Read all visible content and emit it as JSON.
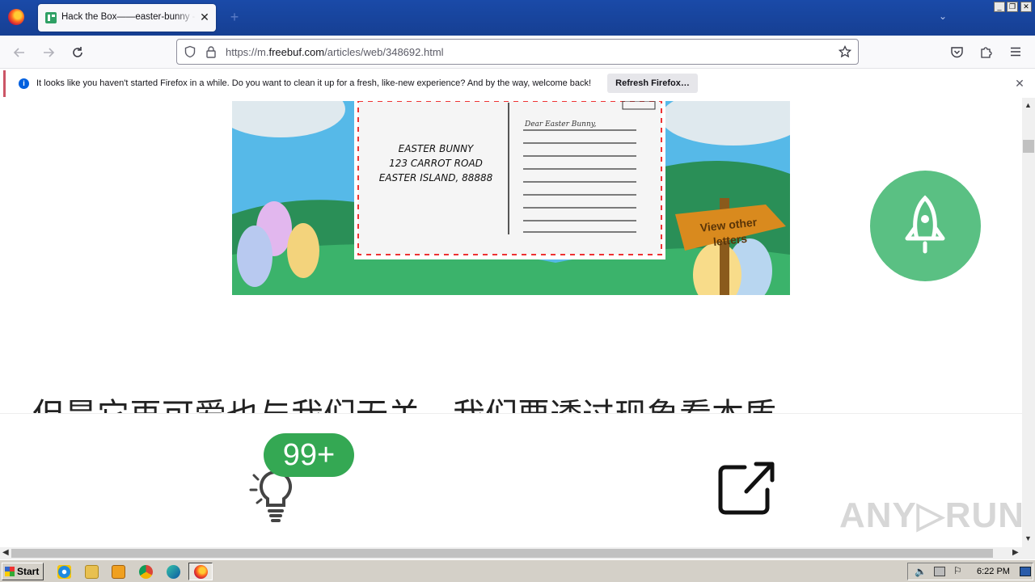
{
  "browser": {
    "tab": {
      "title": "Hack the Box——easter-bunny - FreeBuf",
      "close": "✕"
    },
    "new_tab": "+",
    "url": {
      "prefix": "https://m.",
      "domain": "freebuf.com",
      "path": "/articles/web/348692.html"
    },
    "window_buttons": [
      "_",
      "❐",
      "✕"
    ]
  },
  "notification": {
    "message": "It looks like you haven't started Firefox in a while. Do you want to clean it up for a fresh, like-new experience? And by the way, welcome back!",
    "button": "Refresh Firefox…",
    "close": "✕",
    "info": "i"
  },
  "banner": {
    "address_lines": [
      "EASTER BUNNY",
      "123 CARROT ROAD",
      "EASTER ISLAND, 88888"
    ],
    "greeting": "Dear Easter Bunny,",
    "sign": [
      "View other",
      "letters"
    ]
  },
  "article": {
    "heading": "但是它再可爱也与我们无关，我们要透过现象看本质"
  },
  "actions": {
    "like_count": "99+"
  },
  "watermark": "ANY▷RUN",
  "taskbar": {
    "start": "Start",
    "clock": "6:22 PM"
  },
  "colors": {
    "accent_green": "#5ac083",
    "badge_green": "#34a853",
    "titlebar_blue": "#1a4aa8"
  }
}
